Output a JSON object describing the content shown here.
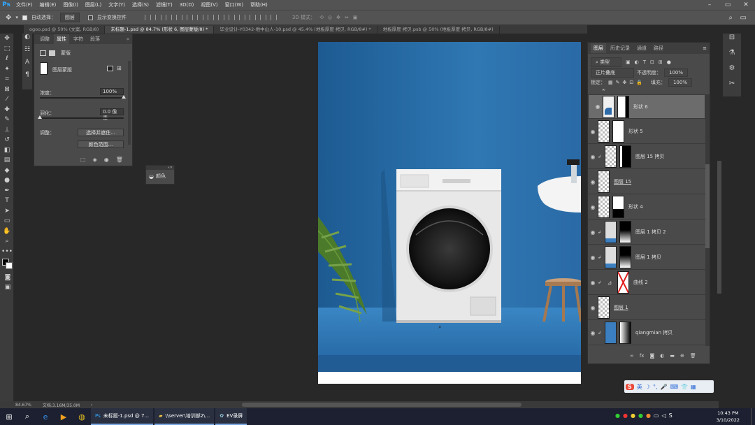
{
  "app": {
    "logo": "Ps"
  },
  "menu": [
    "文件(F)",
    "编辑(E)",
    "图像(I)",
    "图层(L)",
    "文字(Y)",
    "选择(S)",
    "滤镜(T)",
    "3D(D)",
    "视图(V)",
    "窗口(W)",
    "帮助(H)"
  ],
  "options": {
    "auto_select_label": "自动选择：",
    "auto_select_value": "图层",
    "show_transform_label": "显示变换控件",
    "mode3d_label": "3D 模式："
  },
  "tabs": [
    {
      "label": "ogoo.psd @ 50% (文案, RGB/8)",
      "active": false
    },
    {
      "label": "未标题-1.psd @ 84.7% (形状 6, 图层蒙版/8) *",
      "active": true
    },
    {
      "label": "毕业设计-Y0342-地中山人-10.psd @ 45.4% (地板厚度 拷贝, RGB/8#) *",
      "active": false
    },
    {
      "label": "地板厚度 拷贝.psb @ 50% (地板厚度 拷贝, RGB/8#)",
      "active": false
    }
  ],
  "props": {
    "tabs": [
      "调整",
      "属性",
      "字符",
      "段落"
    ],
    "active_tab": "属性",
    "title": "蒙版",
    "section": "图层蒙版",
    "density_label": "浓度：",
    "density_value": "100%",
    "density_level": 1.0,
    "feather_label": "羽化：",
    "feather_value": "0.0 像素",
    "feather_level": 0.0,
    "refine_label": "调整：",
    "btn_select_mask": "选择并遮住...",
    "btn_color_range": "颜色范围..."
  },
  "colorPanel": {
    "label": "颜色"
  },
  "layers": {
    "tabs": [
      "图层",
      "历史记录",
      "通道",
      "路径"
    ],
    "kind_label": "类型",
    "blend_mode": "正片叠底",
    "opacity_label": "不透明度：",
    "opacity_value": "100%",
    "lock_label": "锁定：",
    "fill_label": "填充：",
    "fill_value": "100%",
    "items": [
      {
        "name": "形状 6",
        "selected": true
      },
      {
        "name": "形状 5",
        "selected": false
      },
      {
        "name": "图层 15 拷贝",
        "selected": false
      },
      {
        "name": "图层 15",
        "selected": false
      },
      {
        "name": "形状 4",
        "selected": false
      },
      {
        "name": "图层 1 拷贝 2",
        "selected": false
      },
      {
        "name": "图层 1 拷贝",
        "selected": false
      },
      {
        "name": "曲线 2",
        "selected": false
      },
      {
        "name": "图层 1",
        "selected": false
      },
      {
        "name": "qiangmian 拷贝",
        "selected": false
      }
    ]
  },
  "status": {
    "zoom": "84.67%",
    "doc": "文档:3.16M/35.0M"
  },
  "taskbar": {
    "apps": [
      "未标题-1.psd @ 7...",
      "\\\\server\\培训部2\\...",
      "EV录屏"
    ],
    "time": "10:43 PM",
    "date": "3/10/2022"
  },
  "ime": {
    "label": "英"
  }
}
